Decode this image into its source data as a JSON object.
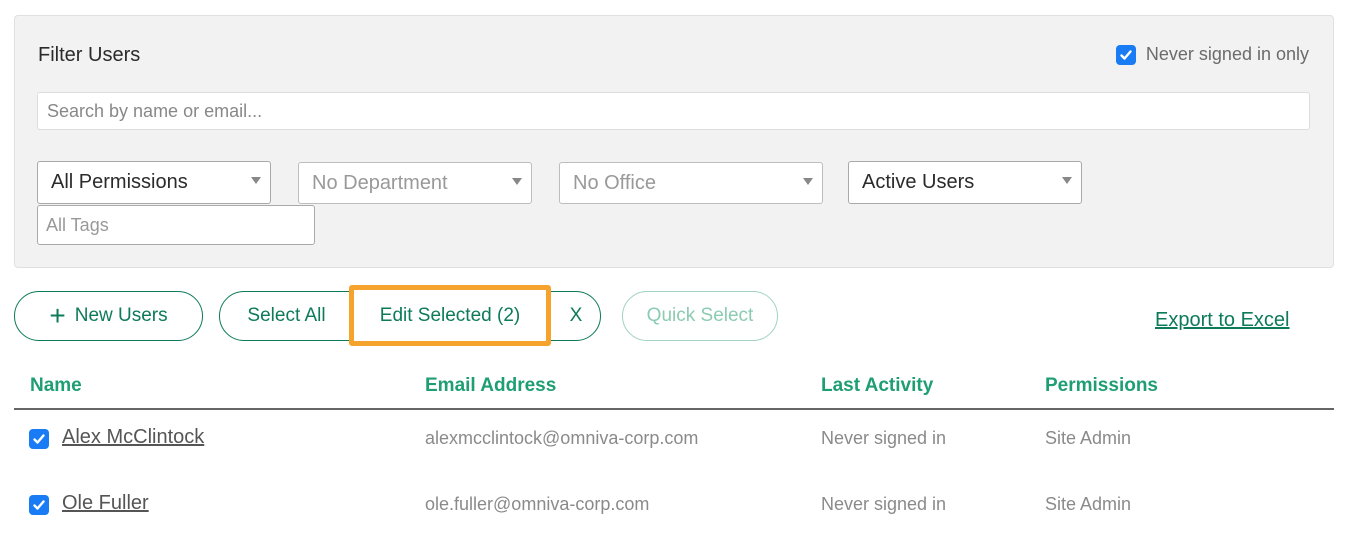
{
  "filter": {
    "title": "Filter Users",
    "never_signed_in_only": {
      "label": "Never signed in only",
      "checked": true
    },
    "search": {
      "placeholder": "Search by name or email...",
      "value": ""
    },
    "permissions_select": {
      "value": "All Permissions"
    },
    "department_select": {
      "value": "No Department"
    },
    "office_select": {
      "value": "No Office"
    },
    "status_select": {
      "value": "Active Users"
    },
    "tags": {
      "placeholder": "All Tags",
      "value": ""
    }
  },
  "toolbar": {
    "new_users_label": "New Users",
    "select_all_label": "Select All",
    "edit_selected_label": "Edit Selected (2)",
    "clear_label": "X",
    "quick_select_label": "Quick Select",
    "export_label": "Export to Excel"
  },
  "table": {
    "columns": [
      "Name",
      "Email Address",
      "Last Activity",
      "Permissions"
    ],
    "rows": [
      {
        "checked": true,
        "name": "Alex McClintock",
        "email": "alexmcclintock@omniva-corp.com",
        "last_activity": "Never signed in",
        "permissions": "Site Admin"
      },
      {
        "checked": true,
        "name": "Ole Fuller",
        "email": "ole.fuller@omniva-corp.com",
        "last_activity": "Never signed in",
        "permissions": "Site Admin"
      }
    ]
  },
  "colors": {
    "brand_green": "#0d7a5a",
    "header_green": "#1f9e74",
    "checkbox_blue": "#1a7cf5",
    "highlight_orange": "#f5a32c"
  }
}
